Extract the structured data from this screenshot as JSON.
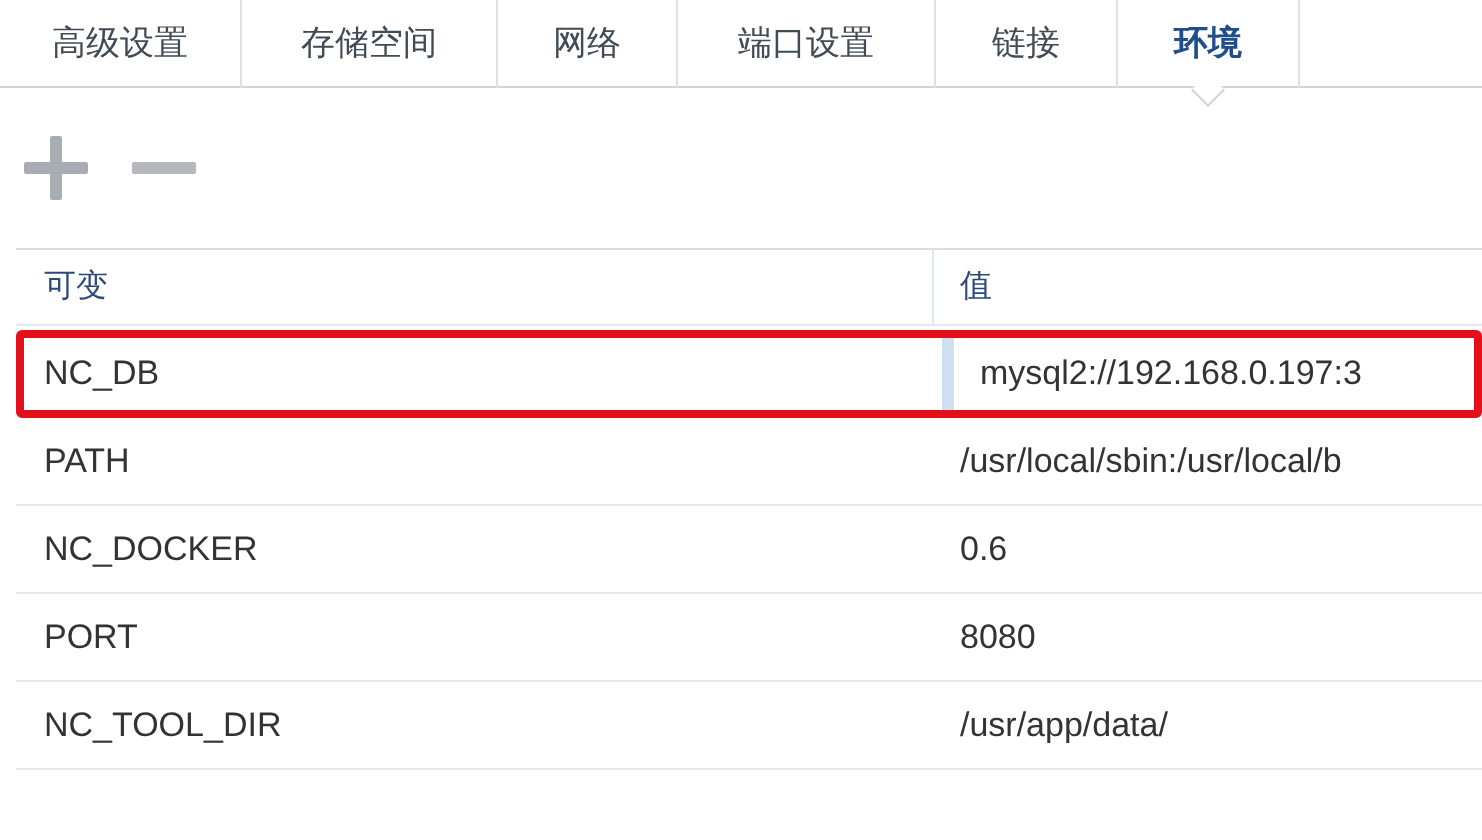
{
  "tabs": [
    {
      "label": "高级设置",
      "selected": false
    },
    {
      "label": "存储空间",
      "selected": false
    },
    {
      "label": "网络",
      "selected": false
    },
    {
      "label": "端口设置",
      "selected": false
    },
    {
      "label": "链接",
      "selected": false
    },
    {
      "label": "环境",
      "selected": true
    }
  ],
  "table": {
    "columns": [
      "可变",
      "值"
    ],
    "rows": [
      {
        "name": "NC_DB",
        "value": "mysql2://192.168.0.197:3",
        "highlighted": true
      },
      {
        "name": "PATH",
        "value": "/usr/local/sbin:/usr/local/b",
        "highlighted": false
      },
      {
        "name": "NC_DOCKER",
        "value": "0.6",
        "highlighted": false
      },
      {
        "name": "PORT",
        "value": "8080",
        "highlighted": false
      },
      {
        "name": "NC_TOOL_DIR",
        "value": "/usr/app/data/",
        "highlighted": false
      }
    ]
  }
}
